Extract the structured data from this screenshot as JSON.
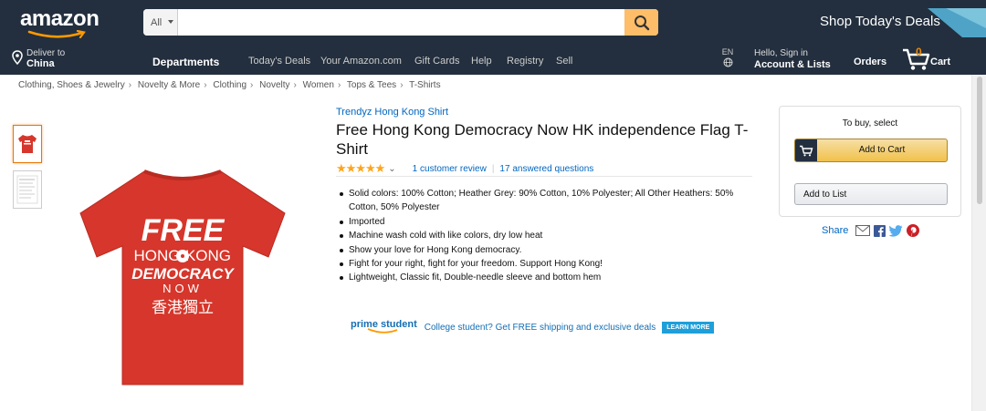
{
  "header": {
    "logo": "amazon",
    "search": {
      "category": "All",
      "placeholder": "",
      "value": ""
    },
    "promo": "Shop Today's Deals",
    "deliver": {
      "line1": "Deliver to",
      "line2": "China"
    },
    "nav": [
      "Departments",
      "Today's Deals",
      "Your Amazon.com",
      "Gift Cards",
      "Help",
      "Registry",
      "Sell"
    ],
    "lang": "EN",
    "account": {
      "line1": "Hello, Sign in",
      "line2": "Account & Lists"
    },
    "orders": "Orders",
    "cart": {
      "count": "0",
      "label": "Cart"
    }
  },
  "breadcrumb": [
    "Clothing, Shoes & Jewelry",
    "Novelty & More",
    "Clothing",
    "Novelty",
    "Women",
    "Tops & Tees",
    "T-Shirts"
  ],
  "product": {
    "brand": "Trendyz Hong Kong Shirt",
    "title": "Free Hong Kong Democracy Now HK independence Flag T-Shirt",
    "rating": {
      "stars": 5,
      "reviews": "1 customer review",
      "questions": "17 answered questions"
    },
    "shirt_text": {
      "line1": "FREE",
      "line2a": "HONG",
      "line2b": "KONG",
      "line3": "DEMOCRACY",
      "line4": "NOW",
      "line5": "香港獨立"
    },
    "bullets": [
      "Solid colors: 100% Cotton; Heather Grey: 90% Cotton, 10% Polyester; All Other Heathers: 50% Cotton, 50% Polyester",
      "Imported",
      "Machine wash cold with like colors, dry low heat",
      "Show your love for Hong Kong democracy.",
      "Fight for your right, fight for your freedom. Support Hong Kong!",
      "Lightweight, Classic fit, Double-needle sleeve and bottom hem"
    ],
    "prime": {
      "logo_a": "prime",
      "logo_b": "student",
      "text": "College student? Get FREE shipping and exclusive deals",
      "button": "LEARN MORE"
    }
  },
  "buybox": {
    "to_buy": "To buy, select",
    "add_to_cart": "Add to Cart",
    "add_to_list": "Add to List",
    "share": "Share"
  },
  "colors": {
    "nav_bg": "#232f3e",
    "search_btn": "#febd69",
    "link": "#0066c0",
    "shirt": "#d6362b",
    "star": "#ffa41c",
    "cart_count": "#f08804"
  }
}
